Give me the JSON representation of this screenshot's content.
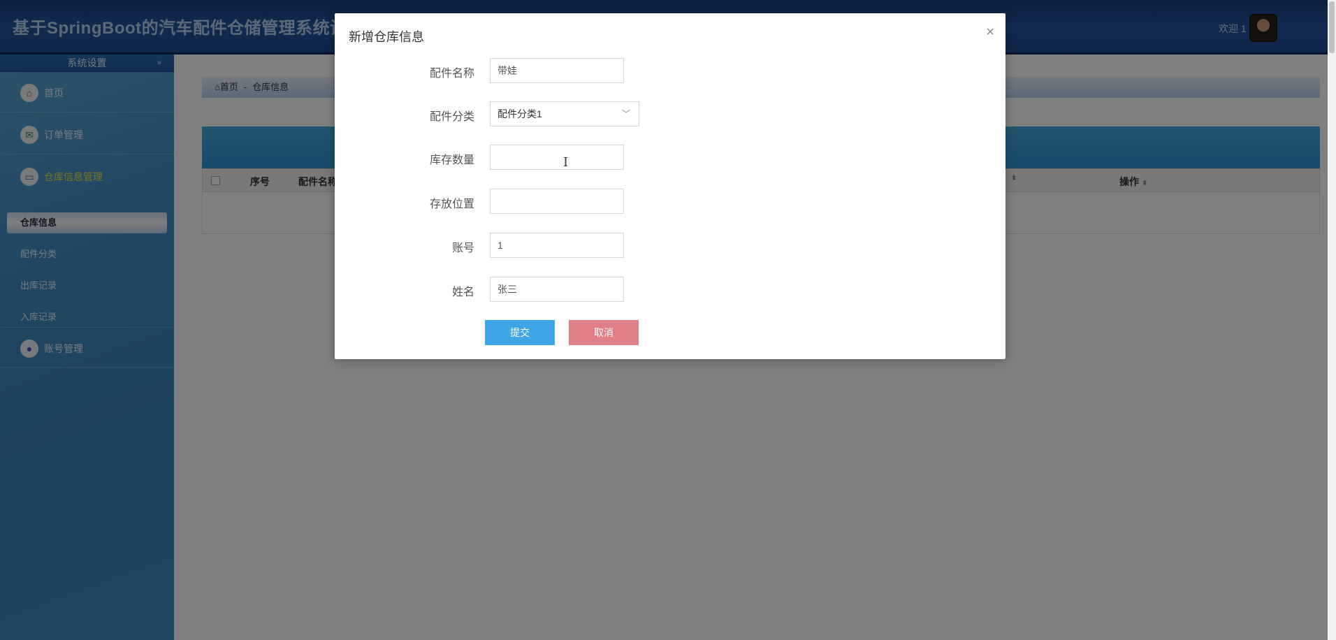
{
  "header": {
    "title": "基于SpringBoot的汽车配件仓储管理系统设",
    "welcome": "欢迎 1"
  },
  "sidebar": {
    "section_title": "系统设置",
    "section_arrow": "»",
    "menus": [
      {
        "label": "首页",
        "icon": "home-icon",
        "glyph": "⌂",
        "color": "#c0392b"
      },
      {
        "label": "订单管理",
        "icon": "order-icon",
        "glyph": "✉",
        "color": "#2e8b57"
      },
      {
        "label": "仓库信息管理",
        "icon": "warehouse-icon",
        "glyph": "▭",
        "color": "#2d6cb2"
      },
      {
        "label": "账号管理",
        "icon": "user-icon",
        "glyph": "●",
        "color": "#3a5ad0"
      }
    ],
    "submenu": [
      "仓库信息",
      "配件分类",
      "出库记录",
      "入库记录"
    ]
  },
  "breadcrumb": {
    "home": "首页",
    "separator": "-",
    "current": "仓库信息"
  },
  "table": {
    "columns": [
      "序号",
      "配件名称",
      "操作"
    ],
    "sort_glyph": "⬍"
  },
  "modal": {
    "title": "新增仓库信息",
    "close": "×",
    "fields": [
      {
        "label": "配件名称",
        "value": "带娃"
      },
      {
        "label": "配件分类",
        "value": "配件分类1"
      },
      {
        "label": "库存数量",
        "value": ""
      },
      {
        "label": "存放位置",
        "value": ""
      },
      {
        "label": "账号",
        "value": "1"
      },
      {
        "label": "姓名",
        "value": "张三"
      }
    ],
    "select_chevron": "﹀",
    "submit": "提交",
    "cancel": "取消"
  }
}
